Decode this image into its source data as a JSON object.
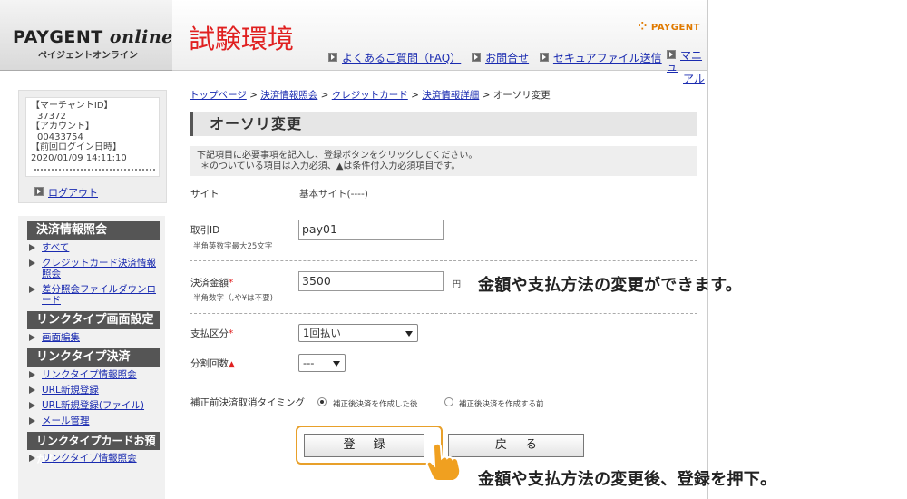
{
  "header": {
    "logo_main": "PAYGENT",
    "logo_italic": "online",
    "logo_sub": "ペイジェントオンライン",
    "env_title": "試験環境",
    "brand": "PAYGENT",
    "nav": [
      "よくあるご質問（FAQ）",
      "お問合せ",
      "セキュアファイル送信"
    ],
    "manual_line1": "マニュ",
    "manual_line2": "アル"
  },
  "account": {
    "lines": [
      "【マーチャントID】",
      "37372",
      "【アカウント】",
      "00433754",
      "【前回ログイン日時】",
      "2020/01/09 14:11:10"
    ],
    "logout": "ログアウト"
  },
  "sidebar": {
    "sections": [
      {
        "title": "決済情報照会",
        "items": [
          "すべて",
          "クレジットカード決済情報照会",
          "差分照会ファイルダウンロード"
        ]
      },
      {
        "title": "リンクタイプ画面設定",
        "items": [
          "画面編集"
        ]
      },
      {
        "title": "リンクタイプ決済",
        "items": [
          "リンクタイプ情報照会",
          "URL新規登録",
          "URL新規登録(ファイル)",
          "メール管理"
        ]
      },
      {
        "title": "リンクタイプカードお預かり",
        "items": [
          "リンクタイプ情報照会"
        ]
      }
    ]
  },
  "breadcrumb": {
    "links": [
      "トップページ",
      "決済情報照会",
      "クレジットカード",
      "決済情報詳細"
    ],
    "current": "オーソリ変更",
    "sep": " > "
  },
  "page": {
    "title": "オーソリ変更",
    "notice_line1": "下記項目に必要事項を記入し、登録ボタンをクリックしてください。",
    "notice_line2": "＊のついている項目は入力必須、▲は条件付入力必須項目です。"
  },
  "form": {
    "site_label": "サイト",
    "site_value": "基本サイト(----)",
    "trade_id_label": "取引ID",
    "trade_id_hint": "半角英数字最大25文字",
    "trade_id_value": "pay01",
    "amount_label": "決済金額",
    "amount_hint": "半角数字（,や¥は不要)",
    "amount_value": "3500",
    "amount_unit": "円",
    "payment_label": "支払区分",
    "payment_value": "1回払い",
    "split_label": "分割回数",
    "split_value": "---",
    "timing_label": "補正前決済取消タイミング",
    "timing_option1": "補正後決済を作成した後",
    "timing_option2": "補正後決済を作成する前",
    "required_mark": "*",
    "conditional_mark": "▲",
    "register_button": "登録",
    "back_button": "戻る"
  },
  "annotations": {
    "note1": "金額や支払方法の変更ができます。",
    "note2": "金額や支払方法の変更後、登録を押下。"
  },
  "colors": {
    "accent_red": "#e02020",
    "link_blue": "#1a2bb0",
    "highlight_orange": "#e8a02a",
    "hand_orange": "#f0a020"
  }
}
